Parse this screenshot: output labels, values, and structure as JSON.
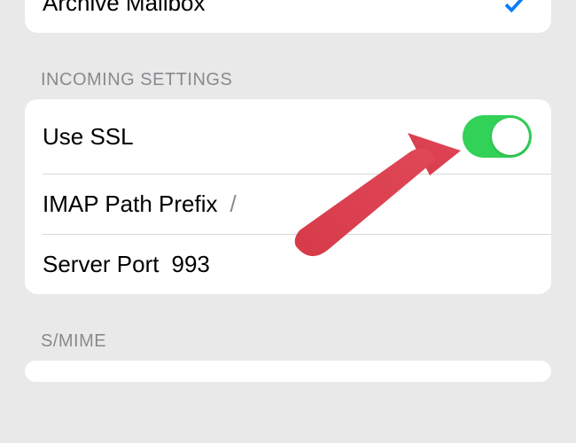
{
  "top_section": {
    "archive_mailbox_label": "Archive Mailbox"
  },
  "incoming": {
    "header": "INCOMING SETTINGS",
    "use_ssl_label": "Use SSL",
    "use_ssl_enabled": true,
    "imap_prefix_label": "IMAP Path Prefix",
    "imap_prefix_value": "/",
    "server_port_label": "Server Port",
    "server_port_value": "993"
  },
  "smime": {
    "header": "S/MIME"
  },
  "annotation": {
    "arrow_color": "#d63b4a"
  }
}
